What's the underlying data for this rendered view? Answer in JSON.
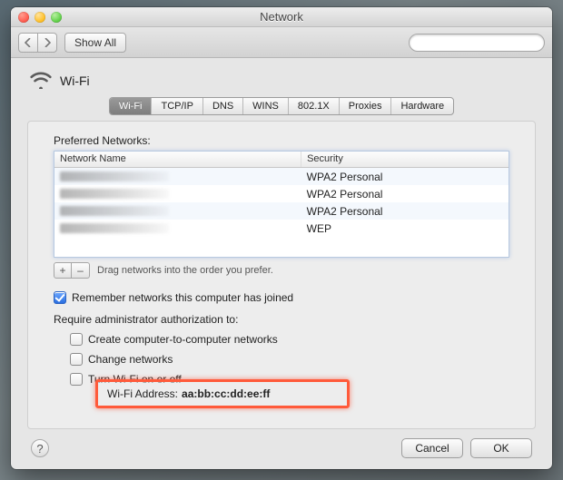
{
  "window": {
    "title": "Network"
  },
  "toolbar": {
    "show_all": "Show All",
    "search_placeholder": ""
  },
  "header": {
    "title": "Wi-Fi"
  },
  "tabs": [
    {
      "label": "Wi-Fi",
      "active": true
    },
    {
      "label": "TCP/IP",
      "active": false
    },
    {
      "label": "DNS",
      "active": false
    },
    {
      "label": "WINS",
      "active": false
    },
    {
      "label": "802.1X",
      "active": false
    },
    {
      "label": "Proxies",
      "active": false
    },
    {
      "label": "Hardware",
      "active": false
    }
  ],
  "preferred": {
    "label": "Preferred Networks:",
    "columns": {
      "name": "Network Name",
      "security": "Security"
    },
    "rows": [
      {
        "security": "WPA2 Personal"
      },
      {
        "security": "WPA2 Personal"
      },
      {
        "security": "WPA2 Personal"
      },
      {
        "security": "WEP"
      }
    ],
    "hint": "Drag networks into the order you prefer.",
    "add": "+",
    "remove": "–"
  },
  "options": {
    "remember": {
      "label": "Remember networks this computer has joined",
      "checked": true
    },
    "require_label": "Require administrator authorization to:",
    "create": {
      "label": "Create computer-to-computer networks",
      "checked": false
    },
    "change": {
      "label": "Change networks",
      "checked": false
    },
    "turn": {
      "label": "Turn Wi-Fi on or off",
      "checked": false
    }
  },
  "address": {
    "label": "Wi-Fi Address:",
    "value": "aa:bb:cc:dd:ee:ff"
  },
  "footer": {
    "help": "?",
    "cancel": "Cancel",
    "ok": "OK"
  }
}
